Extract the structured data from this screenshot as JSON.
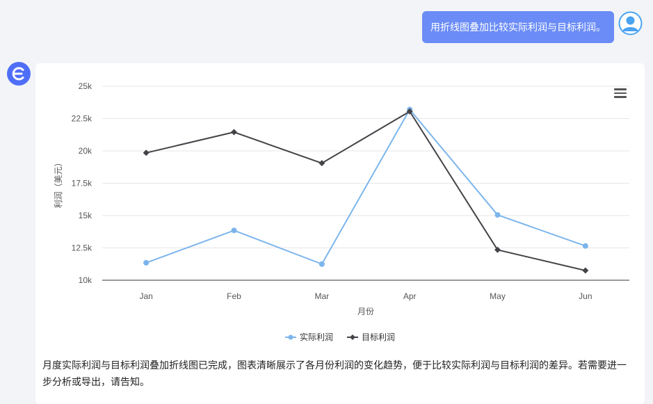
{
  "user_message": "用折线图叠加比较实际利润与目标利润。",
  "assistant_reply": "月度实际利润与目标利润叠加折线图已完成，图表清晰展示了各月份利润的变化趋势，便于比较实际利润与目标利润的差异。若需要进一步分析或导出，请告知。",
  "colors": {
    "user_bubble": "#6b8cf6",
    "actual_series": "#7cb5ec",
    "target_series": "#434348",
    "bot_avatar": "#4f6ef7"
  },
  "icons": {
    "user_avatar": "user-avatar-icon",
    "bot_avatar": "bot-logo-icon",
    "chart_menu": "hamburger-menu-icon"
  },
  "chart_data": {
    "type": "line",
    "categories": [
      "Jan",
      "Feb",
      "Mar",
      "Apr",
      "May",
      "Jun"
    ],
    "series": [
      {
        "name": "实际利润",
        "values": [
          11350,
          13850,
          11250,
          23200,
          15050,
          12650
        ]
      },
      {
        "name": "目标利润",
        "values": [
          19850,
          21450,
          19050,
          23050,
          12350,
          10750
        ]
      }
    ],
    "xlabel": "月份",
    "ylabel": "利润（美元）",
    "ylim": [
      10000,
      25000
    ],
    "yticks": [
      "10k",
      "12.5k",
      "15k",
      "17.5k",
      "20k",
      "22.5k",
      "25k"
    ],
    "grid": true,
    "legend": "bottom-center"
  }
}
